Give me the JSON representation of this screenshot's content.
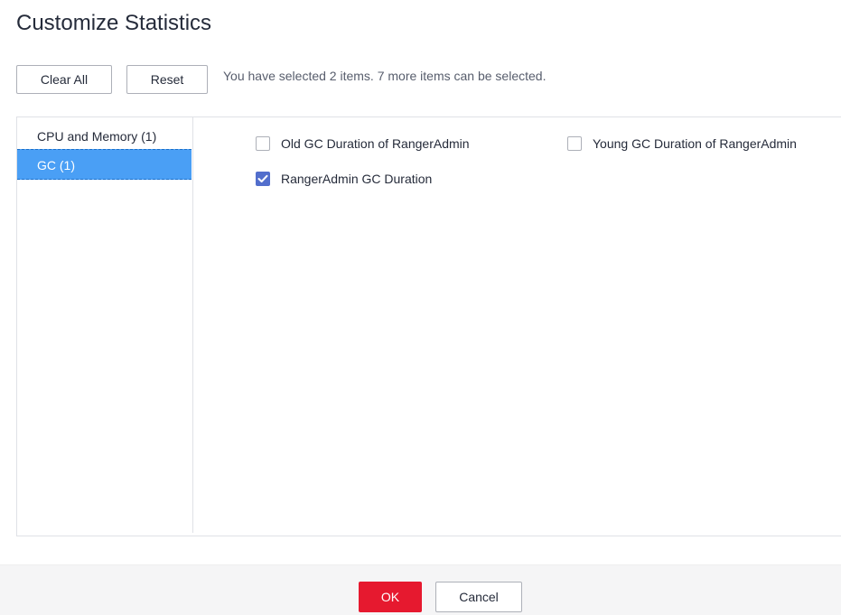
{
  "dialog": {
    "title": "Customize Statistics"
  },
  "toolbar": {
    "clear_all_label": "Clear All",
    "reset_label": "Reset",
    "hint": "You have selected 2 items. 7 more items can be selected."
  },
  "sidebar": {
    "items": [
      {
        "label": "CPU and Memory (1)",
        "selected": false
      },
      {
        "label": "GC (1)",
        "selected": true
      }
    ]
  },
  "options": [
    {
      "label": "Old GC Duration of RangerAdmin",
      "checked": false
    },
    {
      "label": "Young GC Duration of RangerAdmin",
      "checked": false
    },
    {
      "label": "RangerAdmin GC Duration",
      "checked": true
    }
  ],
  "footer": {
    "ok_label": "OK",
    "cancel_label": "Cancel"
  },
  "colors": {
    "selected_item_bg": "#4a9ff5",
    "checkbox_checked": "#526ecc",
    "primary_button": "#e6192f"
  },
  "icons": {
    "checkbox_checked": "check-icon"
  }
}
